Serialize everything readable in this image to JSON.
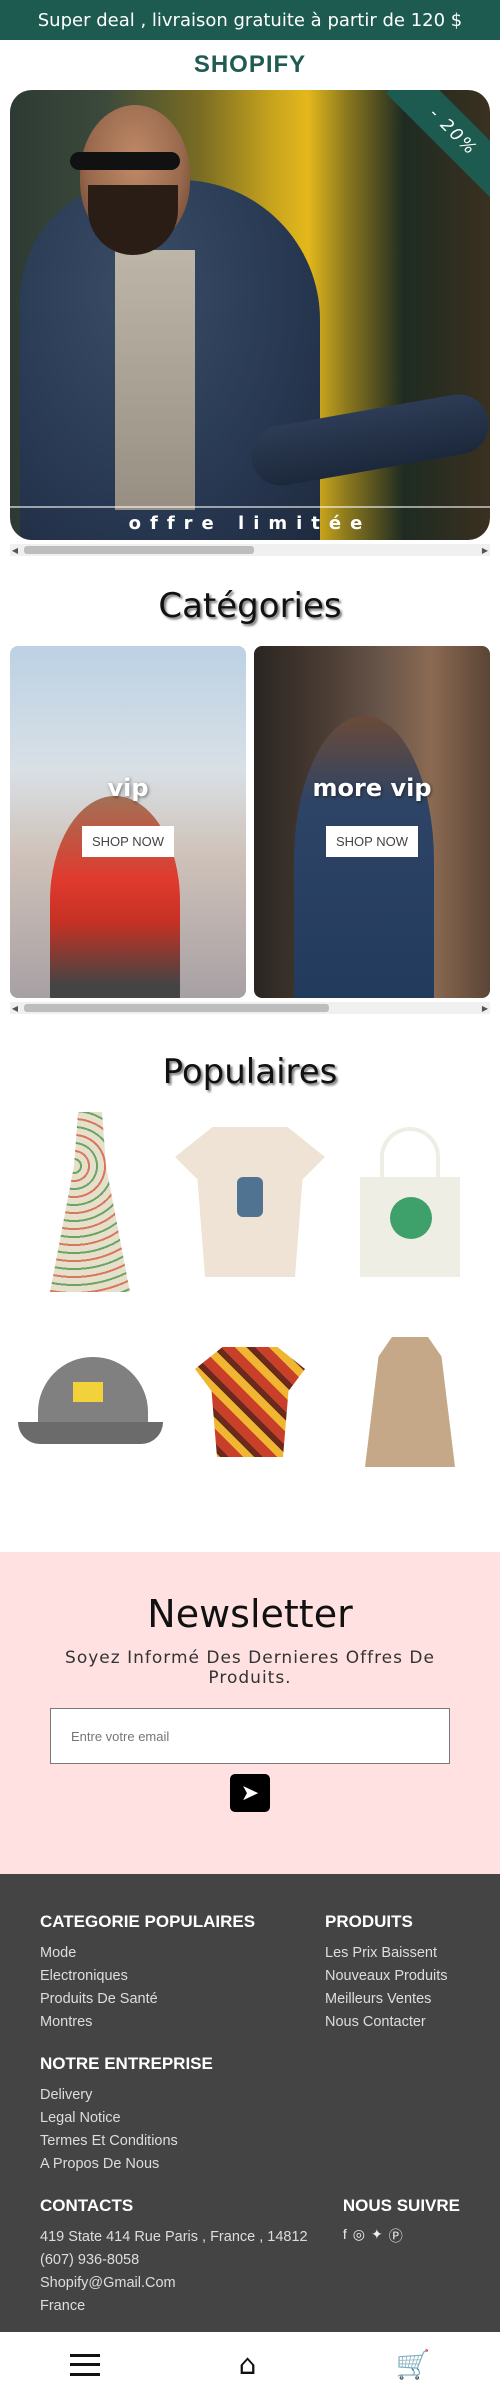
{
  "promo_bar": {
    "text": "Super deal , livraison gratuite à partir de 120 $"
  },
  "brand": {
    "name": "SHOPIFY"
  },
  "hero": {
    "badge": "- 20%",
    "caption": "offre limitée"
  },
  "categories": {
    "title": "Catégories",
    "items": [
      {
        "label": "vip",
        "button": "SHOP NOW"
      },
      {
        "label": "more vip",
        "button": "SHOP NOW"
      }
    ]
  },
  "popular": {
    "title": "Populaires",
    "items": [
      "dress",
      "t-shirt",
      "tote-bag",
      "cap",
      "hawaiian-shirt",
      "trench-coat"
    ]
  },
  "newsletter": {
    "title": "Newsletter",
    "subtitle": "Soyez Informé Des Dernieres Offres De Produits.",
    "email_placeholder": "Entre votre email"
  },
  "footer": {
    "categories": {
      "heading": "CATEGORIE POPULAIRES",
      "links": [
        "Mode",
        "Electroniques",
        "Produits De Santé",
        "Montres"
      ]
    },
    "products": {
      "heading": "PRODUITS",
      "links": [
        "Les Prix Baissent",
        "Nouveaux Produits",
        "Meilleurs Ventes",
        "Nous Contacter"
      ]
    },
    "company": {
      "heading": "NOTRE ENTREPRISE",
      "links": [
        "Delivery",
        "Legal Notice",
        "Termes Et Conditions",
        "A Propos De Nous"
      ]
    },
    "contacts": {
      "heading": "CONTACTS",
      "lines": [
        "419 State 414 Rue Paris , France , 14812",
        "(607) 936-8058",
        "Shopify@Gmail.Com",
        "France"
      ]
    },
    "follow": {
      "heading": "NOUS SUIVRE",
      "icons": [
        "facebook-icon",
        "instagram-icon",
        "twitter-icon",
        "pinterest-icon"
      ]
    }
  },
  "bottom_nav": {
    "icons": [
      "menu-icon",
      "home-icon",
      "cart-icon"
    ]
  }
}
